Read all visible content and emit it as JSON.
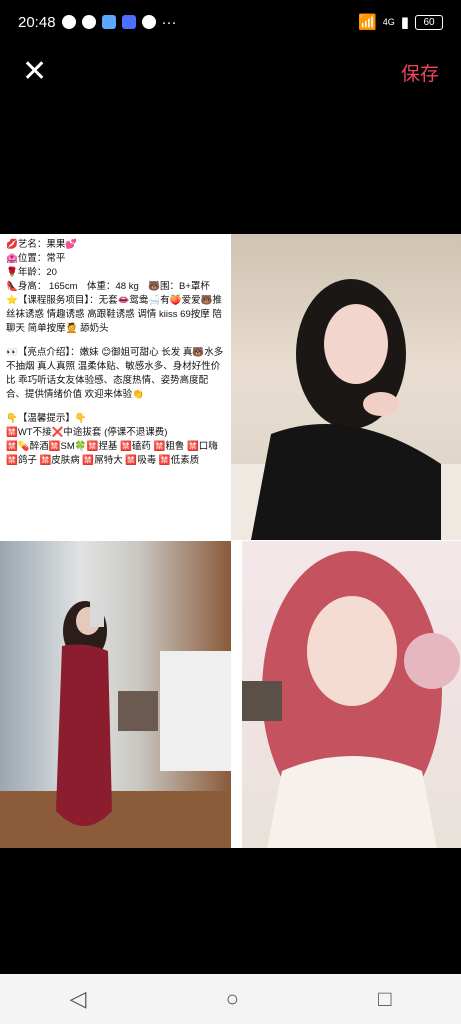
{
  "status_bar": {
    "time": "20:48",
    "more": "···",
    "network": "4G",
    "battery": "60",
    "app_icons": [
      "qq-icon",
      "chat-bubble-icon",
      "browser-icon",
      "app-icon",
      "wechat-icon"
    ]
  },
  "toolbar": {
    "close_glyph": "✕",
    "save_label": "保存"
  },
  "profile": {
    "lines1": [
      "💋艺名：果果💕",
      "🏩位置：常平",
      "🌹年龄：20",
      "👠身高： 165cm　体重：48 kg　🐻围：B+罩杯",
      "⭐【课程服务项目】：无套👄鸳鸯🛁有🍑爱爱🐻推　丝袜诱惑 情趣诱惑 高跟鞋诱惑 调情 kiiss 69按摩 陪聊天 简单按摩💆 舔奶头"
    ],
    "lines2": [
      "👀【亮点介绍】：嫩妹 😊御姐可甜心 长发 真🐻水多 不抽烟 真人真照 温柔体贴、敏感水多、身材好性价比 乖巧听话女友体验感、态度热情、姿势高度配合、提供情绪价值 欢迎来体验👏"
    ],
    "lines3": [
      "👇【温馨提示】👇",
      "🈲WT不接❌中途拔套 (停课不退课费)",
      "🈲💊醉酒🈲SM🍀🈲捏基 🈲磕药 🈲粗鲁 🈲口嗨 🈲鸽子 🈲皮肤病 🈲屌特大 🈲吸毒 🈲低素质"
    ]
  },
  "nav": {
    "back": "◁",
    "home": "○",
    "recents": "□"
  }
}
